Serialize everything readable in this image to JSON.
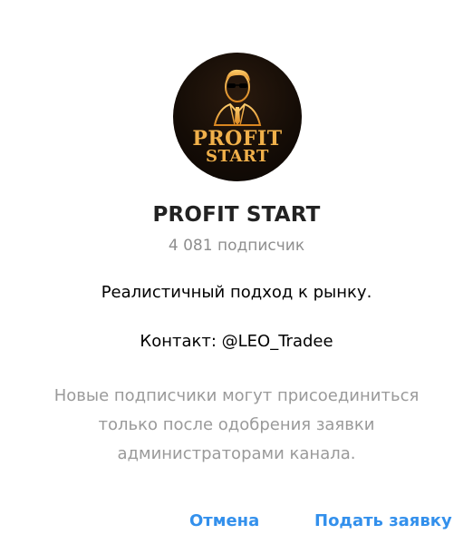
{
  "channel": {
    "avatar_icon": "profit-start-logo",
    "avatar_text_line1": "PROFIT",
    "avatar_text_line2": "START",
    "title": "PROFIT START",
    "subscribers": "4 081 подписчик",
    "description": "Реалистичный подход к рынку.",
    "contact": "Контакт: @LEO_Tradee"
  },
  "notice": {
    "lines": [
      "Новые подписчики могут присоединиться",
      "только после одобрения заявки",
      "администраторами канала."
    ]
  },
  "actions": {
    "cancel_label": "Отмена",
    "submit_label": "Подать заявку"
  },
  "colors": {
    "accent": "#3390ec",
    "muted": "#9a9a9a",
    "logo_gold": "#e8a43a"
  }
}
